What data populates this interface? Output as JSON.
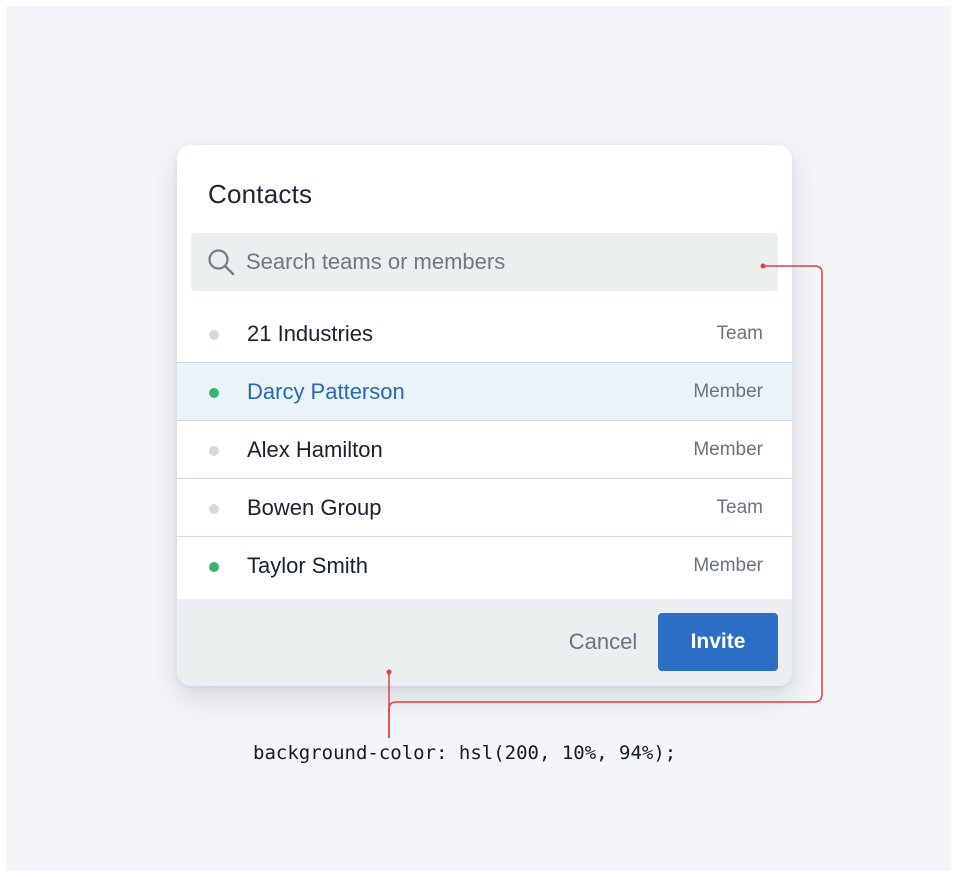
{
  "dialog": {
    "title": "Contacts"
  },
  "search": {
    "placeholder": "Search teams or members",
    "icon": "search-icon"
  },
  "contacts": [
    {
      "name": "21 Industries",
      "type": "Team",
      "status": "offline",
      "selected": false
    },
    {
      "name": "Darcy Patterson",
      "type": "Member",
      "status": "online",
      "selected": true
    },
    {
      "name": "Alex Hamilton",
      "type": "Member",
      "status": "offline",
      "selected": false
    },
    {
      "name": "Bowen Group",
      "type": "Team",
      "status": "offline",
      "selected": false
    },
    {
      "name": "Taylor Smith",
      "type": "Member",
      "status": "online",
      "selected": false
    }
  ],
  "footer": {
    "cancel_label": "Cancel",
    "invite_label": "Invite"
  },
  "annotation": {
    "code": "background-color: hsl(200, 10%, 94%);"
  },
  "colors": {
    "accent": "#2a6fc4",
    "online": "#3bb36a",
    "offline": "#d5d8db",
    "selected_row": "#eaf3fa",
    "selected_text": "#2969b0",
    "footer_background": "#ebeff0",
    "annotation_line": "#e63d3d"
  }
}
